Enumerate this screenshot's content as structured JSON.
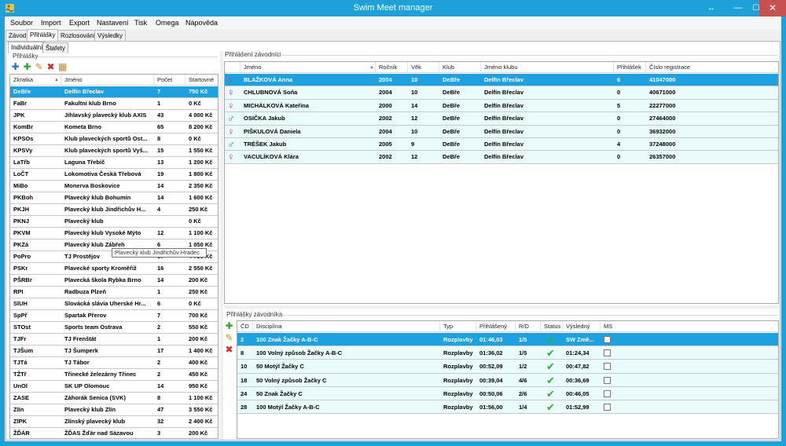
{
  "window": {
    "title": "Swim Meet manager",
    "restore": "↔",
    "minimize": "—",
    "maximize": "☐",
    "close": "✕"
  },
  "menu": [
    "Soubor",
    "Import",
    "Export",
    "Nastavení",
    "Tisk",
    "Omega",
    "Nápověda"
  ],
  "main_tabs": [
    "Závod",
    "Přihlášky",
    "Rozlosování",
    "Výsledky"
  ],
  "sub_tabs": [
    "Individuální",
    "Štafety"
  ],
  "clubs_panel": {
    "group_title": "Přihlášky",
    "columns": [
      "Zkratka",
      "Jméno",
      "Počet",
      "Startovné"
    ],
    "rows": [
      [
        "DeBře",
        "Delfín Břeclav",
        "7",
        "750 Kč"
      ],
      [
        "FaBr",
        "Fakultní klub Brno",
        "1",
        "0 Kč"
      ],
      [
        "JPK",
        "Jihlavský plavecký klub AXIS",
        "43",
        "4 000 Kč"
      ],
      [
        "KomBr",
        "Kometa Brno",
        "65",
        "8 200 Kč"
      ],
      [
        "KPSOs",
        "Klub plaveckých sportů Ost...",
        "8",
        "0 Kč"
      ],
      [
        "KPSVy",
        "Klub plaveckých sportů Vyš...",
        "15",
        "1 550 Kč"
      ],
      [
        "LaTřb",
        "Laguna Třebíč",
        "13",
        "1 200 Kč"
      ],
      [
        "LoČT",
        "Lokomotiva Česká Třebová",
        "19",
        "1 800 Kč"
      ],
      [
        "MiBo",
        "Monerva Boskovice",
        "14",
        "2 350 Kč"
      ],
      [
        "PKBoh",
        "Plavecký klub Bohumín",
        "14",
        "1 600 Kč"
      ],
      [
        "PKJH",
        "Plavecký klub Jindřichův H...",
        "4",
        "250 Kč"
      ],
      [
        "PKNJ",
        "Plavecký klub",
        "",
        "0 Kč"
      ],
      [
        "PKVM",
        "Plavecký klub Vysoké Mýto",
        "12",
        "1 100 Kč"
      ],
      [
        "PKZá",
        "Plavecký klub Zábřeh",
        "6",
        "1 050 Kč"
      ],
      [
        "PoPro",
        "TJ Prostějov",
        "57",
        "4 750 Kč"
      ],
      [
        "PSKr",
        "Plavecké sporty Kroměříž",
        "16",
        "2 550 Kč"
      ],
      [
        "PŠRBr",
        "Plavecká škola Rybka Brno",
        "14",
        "200 Kč"
      ],
      [
        "RPI",
        "Radbuza Plzeň",
        "1",
        "250 Kč"
      ],
      [
        "SlUH",
        "Slovácká slávia Uherské Hr...",
        "6",
        "0 Kč"
      ],
      [
        "SpPř",
        "Spartak Přerov",
        "7",
        "700 Kč"
      ],
      [
        "STOst",
        "Sports team Ostrava",
        "2",
        "550 Kč"
      ],
      [
        "TJFr",
        "TJ Frenštát",
        "1",
        "200 Kč"
      ],
      [
        "TJŠum",
        "TJ Šumperk",
        "17",
        "1 400 Kč"
      ],
      [
        "TJTá",
        "TJ Tábor",
        "2",
        "400 Kč"
      ],
      [
        "TŽTř",
        "Třinecké železárny Třinec",
        "2",
        "450 Kč"
      ],
      [
        "UnOl",
        "SK UP Olomouc",
        "14",
        "950 Kč"
      ],
      [
        "ZASE",
        "Záhorák Senica (SVK)",
        "8",
        "1 100 Kč"
      ],
      [
        "Zlín",
        "Plavecký klub Zlín",
        "47",
        "3 550 Kč"
      ],
      [
        "ZlPK",
        "Zlínský plavecký klub",
        "32",
        "2 400 Kč"
      ],
      [
        "ŽĎÁR",
        "ŽĎAS Žďár nad Sázavou",
        "3",
        "200 Kč"
      ]
    ],
    "tooltip": "Plavecký klub Jindřichův Hradec"
  },
  "swimmers_panel": {
    "group_title": "Přihlášení závodníci",
    "columns": [
      "Jméno",
      "Ročník",
      "Věk",
      "Klub",
      "Jméno klubu",
      "Přihlášek",
      "Číslo registrace"
    ],
    "rows": [
      {
        "gender": "female",
        "cells": [
          "BLAŽKOVÁ Anna",
          "2004",
          "10",
          "DeBře",
          "Delfín Břeclav",
          "6",
          "41047000"
        ]
      },
      {
        "gender": "female",
        "cells": [
          "CHLUBNOVÁ Soňa",
          "2004",
          "10",
          "DeBře",
          "Delfín Břeclav",
          "0",
          "40671000"
        ]
      },
      {
        "gender": "female",
        "cells": [
          "MICHÁLKOVÁ Kateřina",
          "2000",
          "14",
          "DeBře",
          "Delfín Břeclav",
          "5",
          "22277000"
        ]
      },
      {
        "gender": "male",
        "cells": [
          "OSIČKA Jakub",
          "2002",
          "12",
          "DeBře",
          "Delfín Břeclav",
          "0",
          "27464000"
        ]
      },
      {
        "gender": "female",
        "cells": [
          "PIŠKULOVÁ Daniela",
          "2004",
          "10",
          "DeBře",
          "Delfín Břeclav",
          "0",
          "36932000"
        ]
      },
      {
        "gender": "male",
        "cells": [
          "TRÉŠEK Jakub",
          "2005",
          "9",
          "DeBře",
          "Delfín Břeclav",
          "4",
          "37248000"
        ]
      },
      {
        "gender": "female",
        "cells": [
          "VACULÍKOVÁ Klára",
          "2002",
          "12",
          "DeBře",
          "Delfín Břeclav",
          "0",
          "26357000"
        ]
      }
    ],
    "icons": {
      "female": "♀",
      "male": "♂"
    }
  },
  "entries_panel": {
    "group_title": "Přihlášky závodníka",
    "columns": [
      "ČD",
      "Disciplína",
      "Typ",
      "Přihlášený",
      "R/D",
      "Status",
      "Výsledný",
      "MS"
    ],
    "rows": [
      [
        "2",
        "100 Znak Žačky A-B-C",
        "Rozplavby",
        "01:46,03",
        "1/5",
        "SW Změ..."
      ],
      [
        "8",
        "100 Volný způsob Žačky A-B-C",
        "Rozplavby",
        "01:36,02",
        "1/5",
        "01:24,34"
      ],
      [
        "10",
        "50 Motýl Žačky C",
        "Rozplavby",
        "00:52,09",
        "1/2",
        "00:47,82"
      ],
      [
        "18",
        "50 Volný způsob Žačky C",
        "Rozplavby",
        "00:39,04",
        "4/6",
        "00:36,69"
      ],
      [
        "24",
        "50 Znak Žačky C",
        "Rozplavby",
        "00:50,06",
        "2/6",
        "00:46,05"
      ],
      [
        "28",
        "100 Motýl Žačky A-B-C",
        "Rozplavby",
        "01:56,00",
        "1/4",
        "01:52,99"
      ]
    ],
    "status_icon": "✔"
  },
  "toolbar_icons": {
    "add": "✚",
    "edit": "✎",
    "delete": "✖",
    "print": "▦",
    "sort": "▲"
  }
}
